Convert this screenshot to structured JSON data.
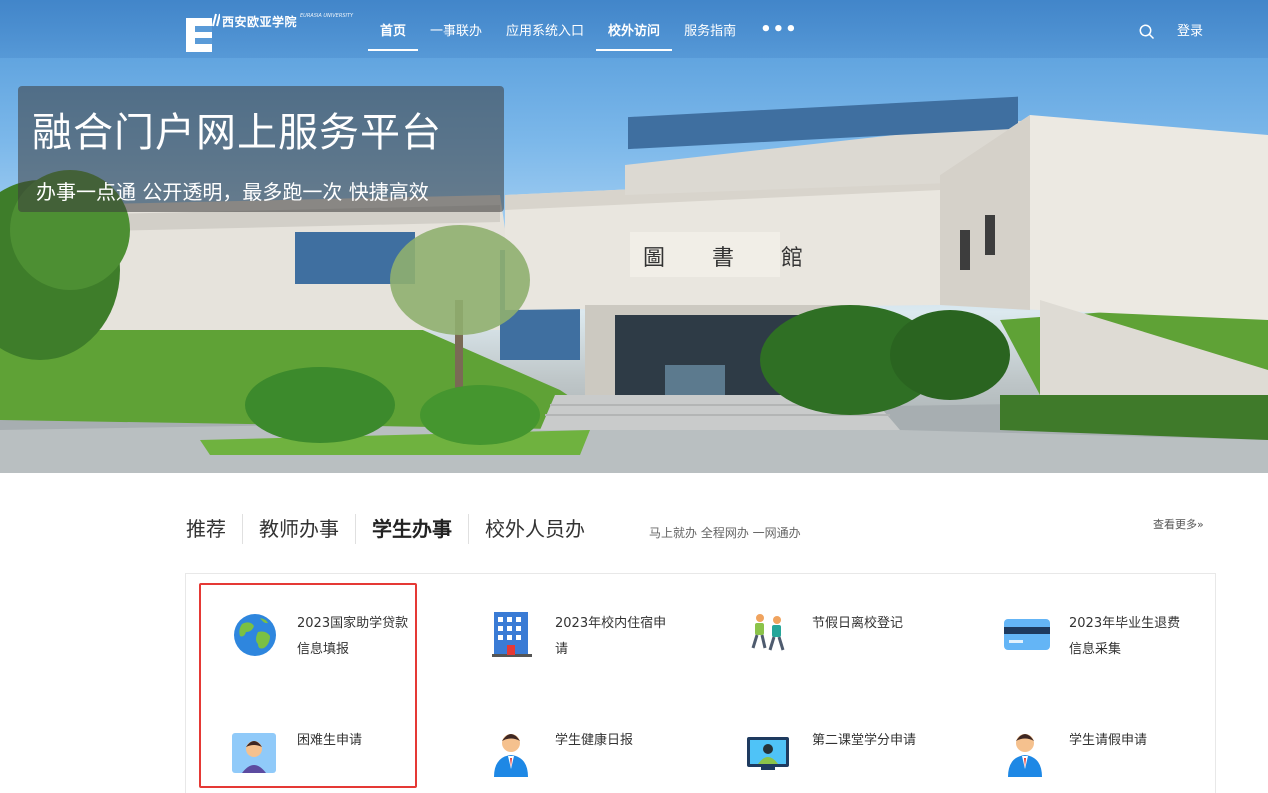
{
  "header": {
    "logo_title": "西安欧亚学院",
    "logo_subtitle": "EURASIA UNIVERSITY",
    "nav": [
      {
        "label": "首页",
        "active": true
      },
      {
        "label": "一事联办",
        "active": false
      },
      {
        "label": "应用系统入口",
        "active": false
      },
      {
        "label": "校外访问",
        "active": true
      },
      {
        "label": "服务指南",
        "active": false
      }
    ],
    "more_label": "•••",
    "login_label": "登录"
  },
  "hero": {
    "title": "融合门户网上服务平台",
    "subtitle": "办事一点通 公开透明，最多跑一次 快捷高效",
    "building_sign": "圖 書 館"
  },
  "services": {
    "tabs": [
      {
        "label": "推荐",
        "active": false
      },
      {
        "label": "教师办事",
        "active": false
      },
      {
        "label": "学生办事",
        "active": true
      },
      {
        "label": "校外人员办",
        "active": false
      }
    ],
    "slogan": "马上就办 全程网办 一网通办",
    "more_label": "查看更多»",
    "items": [
      {
        "label": "2023国家助学贷款信息填报",
        "icon": "globe-icon"
      },
      {
        "label": "2023年校内住宿申请",
        "icon": "building-icon"
      },
      {
        "label": "节假日离校登记",
        "icon": "hikers-icon"
      },
      {
        "label": "2023年毕业生退费信息采集",
        "icon": "credit-card-icon"
      },
      {
        "label": "困难生申请",
        "icon": "student-portrait-icon"
      },
      {
        "label": "学生健康日报",
        "icon": "student-avatar-icon"
      },
      {
        "label": "第二课堂学分申请",
        "icon": "monitor-user-icon"
      },
      {
        "label": "学生请假申请",
        "icon": "student-avatar-icon"
      }
    ]
  },
  "colors": {
    "nav_bg": "#3878be",
    "highlight_border": "#e53935",
    "accent_blue": "#1e88e5"
  }
}
